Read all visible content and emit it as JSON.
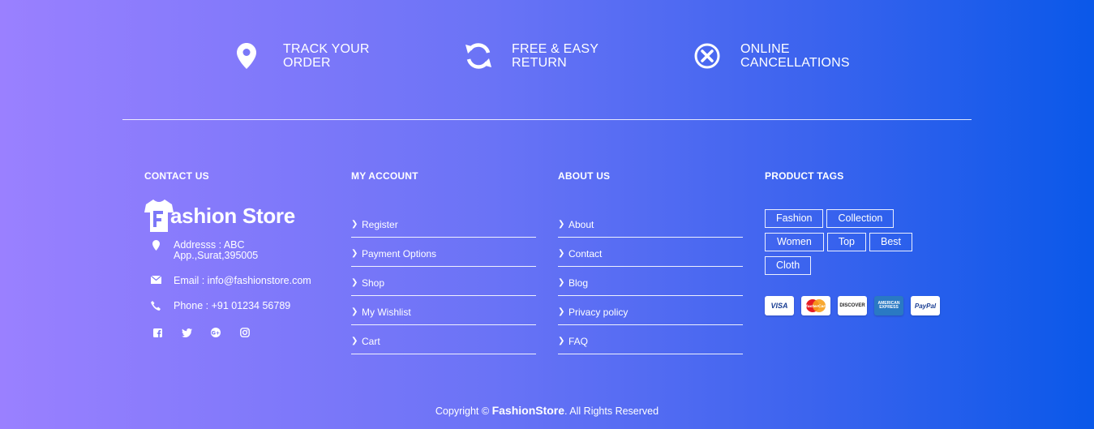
{
  "features": [
    {
      "icon": "map-marker-icon",
      "line1": "TRACK YOUR",
      "line2": "ORDER"
    },
    {
      "icon": "refresh-icon",
      "line1": "FREE & EASY",
      "line2": "RETURN"
    },
    {
      "icon": "cancel-circle-icon",
      "line1": "ONLINE",
      "line2": "CANCELLATIONS"
    }
  ],
  "contact": {
    "heading": "CONTACT US",
    "logo_text": "ashion Store",
    "address": "Addresss : ABC App.,Surat,395005",
    "email": "Email : info@fashionstore.com",
    "phone": "Phone : +91 01234 56789"
  },
  "account": {
    "heading": "MY ACCOUNT",
    "links": [
      "Register",
      "Payment Options",
      "Shop",
      "My Wishlist",
      "Cart"
    ]
  },
  "about": {
    "heading": "ABOUT US",
    "links": [
      "About",
      "Contact",
      "Blog",
      "Privacy policy",
      "FAQ"
    ]
  },
  "tags": {
    "heading": "PRODUCT TAGS",
    "items": [
      "Fashion",
      "Collection",
      "Women",
      "Top",
      "Best",
      "Cloth"
    ]
  },
  "payment_cards": [
    "VISA",
    "MasterCard",
    "DISCOVER",
    "AMERICAN EXPRESS",
    "PayPal"
  ],
  "copyright": {
    "prefix": "Copyright ©",
    "brand": "FashionStore",
    "suffix": ". All Rights Reserved"
  }
}
